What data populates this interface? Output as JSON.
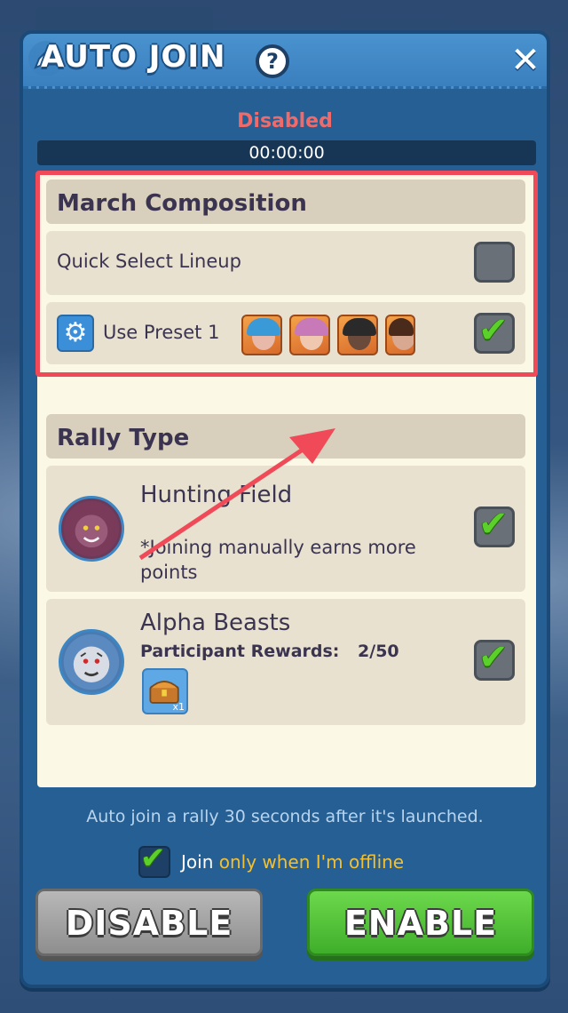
{
  "header": {
    "title": "AUTO JOIN",
    "help_glyph": "?",
    "close_glyph": "✕"
  },
  "status": {
    "state": "Disabled",
    "timer": "00:00:00",
    "state_color": "#f06a6a"
  },
  "march_composition": {
    "title": "March Composition",
    "quick_select": {
      "label": "Quick Select Lineup",
      "checked": false
    },
    "preset": {
      "label": "Use Preset 1",
      "checked": true,
      "icon": "gear-icon",
      "hero_count": 4
    }
  },
  "rally_type": {
    "title": "Rally Type",
    "items": [
      {
        "name": "Hunting Field",
        "note": "*Joining manually earns more points",
        "icon": "lion-beast-icon",
        "checked": true
      },
      {
        "name": "Alpha Beasts",
        "rewards_label": "Participant Rewards:",
        "rewards_value": "2/50",
        "icon": "white-tiger-icon",
        "reward_item": "chest-icon",
        "reward_qty": "x1",
        "checked": true
      }
    ]
  },
  "footer": {
    "note": "Auto join a rally 30 seconds after it's launched.",
    "offline": {
      "prefix": "Join",
      "accent": "only when I'm offline",
      "checked": true
    }
  },
  "buttons": {
    "disable": "DISABLE",
    "enable": "ENABLE"
  },
  "colors": {
    "accent_green": "#5bd02a",
    "highlight_red": "#f04a58",
    "panel_blue": "#255f93"
  }
}
